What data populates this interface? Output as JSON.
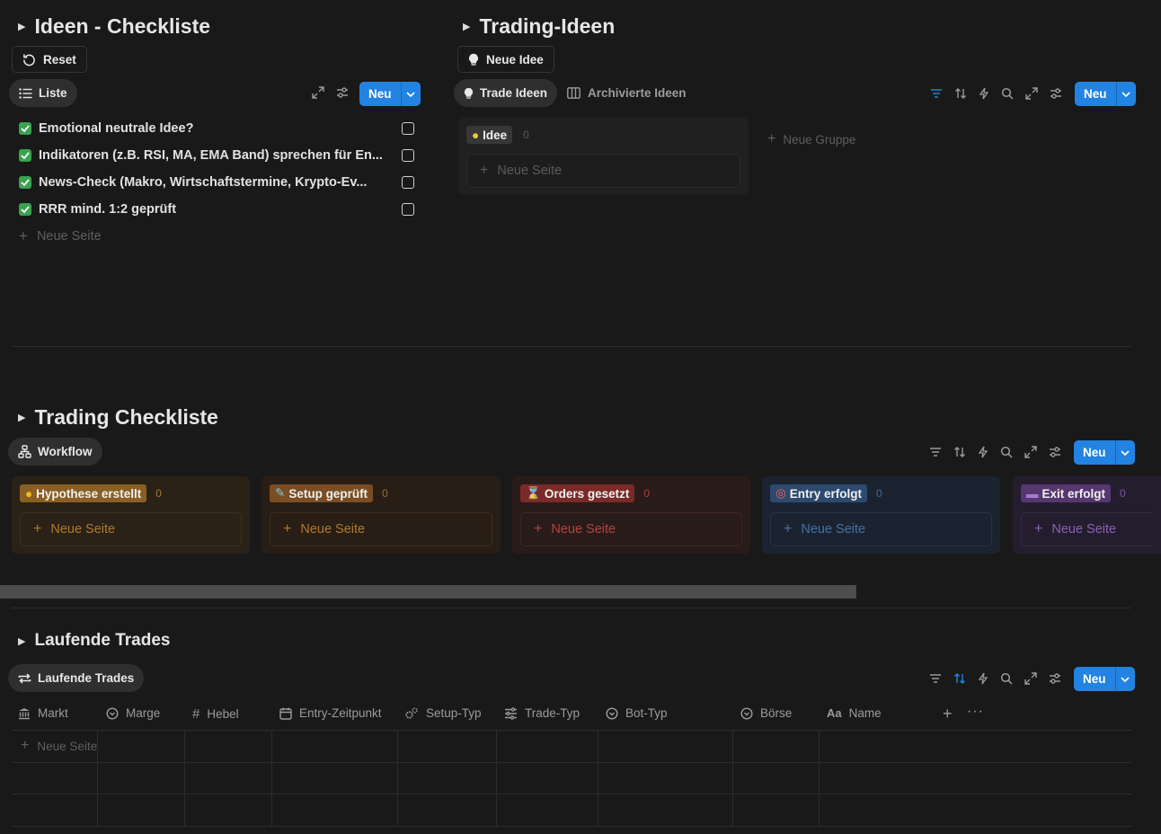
{
  "ideen_checkliste": {
    "title": "Ideen - Checkliste",
    "reset_label": "Reset",
    "view_tab": "Liste",
    "new_label": "Neu",
    "items": [
      {
        "label": "Emotional neutrale Idee?",
        "checked": true
      },
      {
        "label": "Indikatoren (z.B. RSI, MA, EMA Band) sprechen für En...",
        "checked": true
      },
      {
        "label": "News-Check (Makro, Wirtschaftstermine, Krypto-Ev...",
        "checked": true
      },
      {
        "label": "RRR mind. 1:2 geprüft",
        "checked": true
      }
    ],
    "add_page": "Neue Seite"
  },
  "trading_ideen": {
    "title": "Trading-Ideen",
    "new_idea_label": "Neue Idee",
    "tabs": [
      "Trade Ideen",
      "Archivierte Ideen"
    ],
    "new_label": "Neu",
    "group": {
      "label": "Idee",
      "count": "0",
      "add_page": "Neue Seite"
    },
    "add_group": "Neue Gruppe"
  },
  "trading_checkliste": {
    "title": "Trading Checkliste",
    "view_tab": "Workflow",
    "new_label": "Neu",
    "columns": [
      {
        "label": "Hypothese erstellt",
        "count": "0",
        "add_page": "Neue Seite",
        "color": "#b27a2a"
      },
      {
        "label": "Setup geprüft",
        "count": "0",
        "add_page": "Neue Seite",
        "color": "#8c5a22"
      },
      {
        "label": "Orders gesetzt",
        "count": "0",
        "add_page": "Neue Seite",
        "color": "#8c2e2c"
      },
      {
        "label": "Entry erfolgt",
        "count": "0",
        "add_page": "Neue Seite",
        "color": "#28456a"
      },
      {
        "label": "Exit erfolgt",
        "count": "0",
        "add_page": "Neue Seite",
        "color": "#5b3a78"
      }
    ]
  },
  "laufende_trades": {
    "title": "Laufende Trades",
    "view_tab": "Laufende Trades",
    "new_label": "Neu",
    "columns": [
      "Markt",
      "Marge",
      "Hebel",
      "Entry-Zeitpunkt",
      "Setup-Typ",
      "Trade-Typ",
      "Bot-Typ",
      "Börse",
      "Name"
    ],
    "add_page": "Neue Seite"
  },
  "colors": {
    "accent": "#2383e2",
    "background": "#191919"
  }
}
